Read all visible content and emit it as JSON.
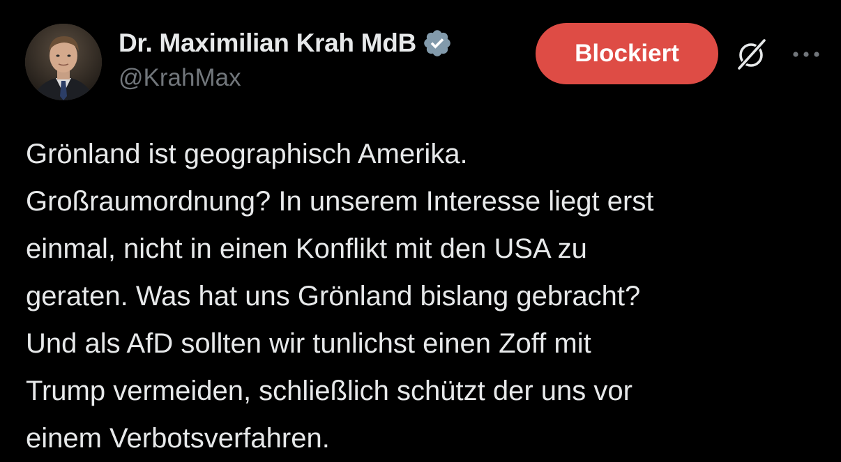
{
  "author": {
    "display_name": "Dr. Maximilian Krah MdB",
    "handle": "@KrahMax",
    "verified_icon": "verified-badge-icon",
    "avatar_icon": "profile-photo"
  },
  "actions": {
    "blocked_label": "Blockiert",
    "grok_icon": "grok-icon",
    "more_icon": "more-options-icon"
  },
  "tweet": {
    "lines": [
      "Grönland ist geographisch Amerika.",
      "Großraumordnung? In unserem Interesse liegt erst",
      "einmal, nicht in einen Konflikt mit den USA zu",
      "geraten. Was hat uns Grönland bislang gebracht?",
      "Und als AfD sollten wir tunlichst einen Zoff mit",
      "Trump vermeiden, schließlich schützt der uns vor",
      "einem Verbotsverfahren."
    ]
  },
  "colors": {
    "background": "#000000",
    "text": "#e7e9ea",
    "muted": "#71767b",
    "blocked_button": "#de4c45",
    "verified_badge": "#829aab"
  }
}
